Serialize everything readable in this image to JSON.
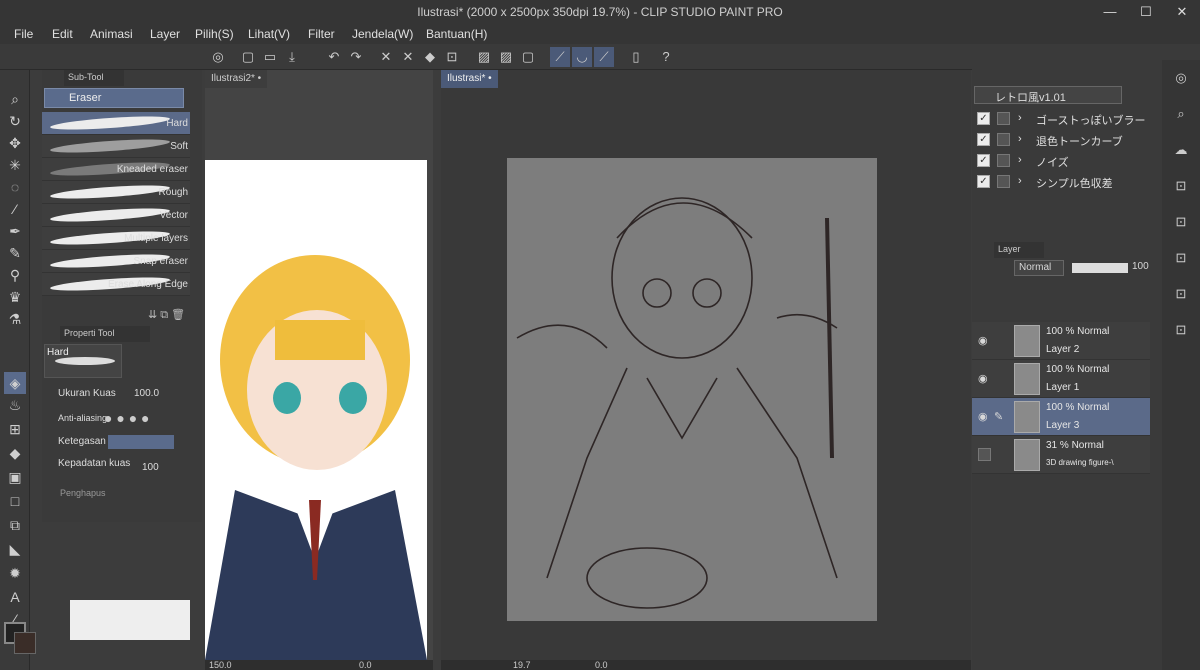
{
  "window": {
    "title": "Ilustrasi* (2000 x 2500px 350dpi 19.7%)  - CLIP STUDIO PAINT PRO",
    "minimize": "—",
    "maximize": "☐",
    "close": "✕"
  },
  "menu": [
    "File",
    "Edit",
    "Animasi",
    "Layer",
    "Pilih(S)",
    "Lihat(V)",
    "Filter",
    "Jendela(W)",
    "Bantuan(H)"
  ],
  "subtool": {
    "tab_label": "Sub-Tool",
    "group_label": "Eraser",
    "brushes": [
      "Hard",
      "Soft",
      "Kneaded eraser",
      "Rough",
      "Vector",
      "Multiple layers",
      "Snap eraser",
      "Erase Along Edge"
    ]
  },
  "property": {
    "tab_label": "Properti Tool",
    "preset_name": "Hard",
    "brush_size_label": "Ukuran Kuas",
    "brush_size_value": "100.0",
    "antialias_label": "Anti-aliasing",
    "hardness_label": "Ketegasan",
    "density_label": "Kepadatan kuas",
    "density_value": "100",
    "eraser_footer": "Penghapus"
  },
  "documents": {
    "left_tab": "Ilustrasi2*",
    "right_tab": "Ilustrasi*"
  },
  "status": {
    "left_zoom": "150.0",
    "left_angle": "0.0",
    "right_zoom": "19.7",
    "right_angle": "0.0"
  },
  "filters": {
    "preset": "レトロ風v1.01",
    "items": [
      "ゴーストっぽいブラー",
      "退色トーンカーブ",
      "ノイズ",
      "シンプル色収差"
    ]
  },
  "layer_panel": {
    "tab_label": "Layer",
    "blend_mode": "Normal",
    "opacity": "100",
    "layers": [
      {
        "mode": "100 % Normal",
        "name": "Layer 2",
        "selected": false
      },
      {
        "mode": "100 % Normal",
        "name": "Layer 1",
        "selected": false
      },
      {
        "mode": "100 % Normal",
        "name": "Layer 3",
        "selected": true
      },
      {
        "mode": "31 % Normal",
        "name": "3D drawing figure-\\",
        "selected": false
      }
    ]
  },
  "colors": {
    "accent": "#5b6a89",
    "panel": "#3a3a3a",
    "canvas_bg": "#7d7d7d"
  }
}
